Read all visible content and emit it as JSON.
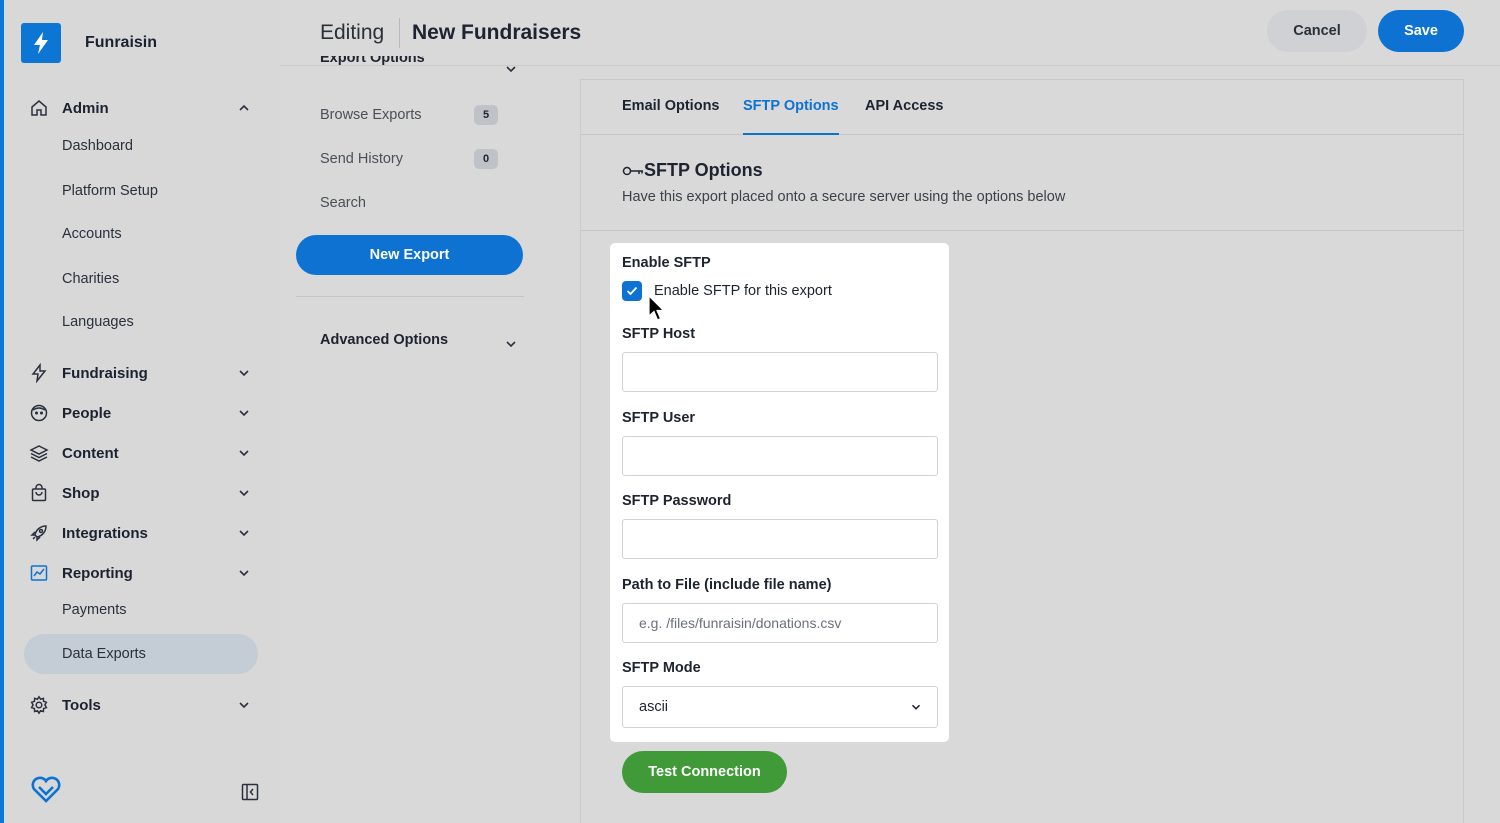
{
  "brand": {
    "name": "Funraisin"
  },
  "colors": {
    "accent": "#0d72d2",
    "success": "#3f9a37",
    "active_nav": "#c4ccd6"
  },
  "sidebar": {
    "groups": [
      {
        "label": "Admin",
        "icon": "home-icon",
        "expanded": true
      },
      {
        "label": "Fundraising",
        "icon": "bolt-icon",
        "expanded": false
      },
      {
        "label": "People",
        "icon": "face-icon",
        "expanded": false
      },
      {
        "label": "Content",
        "icon": "layers-icon",
        "expanded": false
      },
      {
        "label": "Shop",
        "icon": "bag-icon",
        "expanded": false
      },
      {
        "label": "Integrations",
        "icon": "rocket-icon",
        "expanded": false
      },
      {
        "label": "Reporting",
        "icon": "chart-icon",
        "expanded": true
      },
      {
        "label": "Tools",
        "icon": "gear-icon",
        "expanded": false
      }
    ],
    "admin_items": [
      "Dashboard",
      "Platform Setup",
      "Accounts",
      "Charities",
      "Languages"
    ],
    "reporting_items": [
      "Payments",
      "Data Exports"
    ],
    "active_item": "Data Exports"
  },
  "header": {
    "mode": "Editing",
    "title": "New Fundraisers",
    "cancel_label": "Cancel",
    "save_label": "Save"
  },
  "middle": {
    "section_label": "Export Options",
    "items": [
      {
        "label": "Browse Exports",
        "count": "5"
      },
      {
        "label": "Send History",
        "count": "0"
      },
      {
        "label": "Search"
      }
    ],
    "new_export_label": "New Export",
    "advanced_label": "Advanced Options"
  },
  "main": {
    "tabs": [
      "Email Options",
      "SFTP Options",
      "API Access"
    ],
    "active_tab": "SFTP Options",
    "section_title": "SFTP Options",
    "section_desc": "Have this export placed onto a secure server using the options below",
    "form": {
      "enable_label": "Enable SFTP",
      "enable_checkbox_label": "Enable SFTP for this export",
      "enable_checked": true,
      "host_label": "SFTP Host",
      "host_value": "",
      "user_label": "SFTP User",
      "user_value": "",
      "password_label": "SFTP Password",
      "password_value": "",
      "path_label": "Path to File (include file name)",
      "path_placeholder": "e.g. /files/funraisin/donations.csv",
      "mode_label": "SFTP Mode",
      "mode_value": "ascii"
    },
    "test_label": "Test Connection"
  }
}
